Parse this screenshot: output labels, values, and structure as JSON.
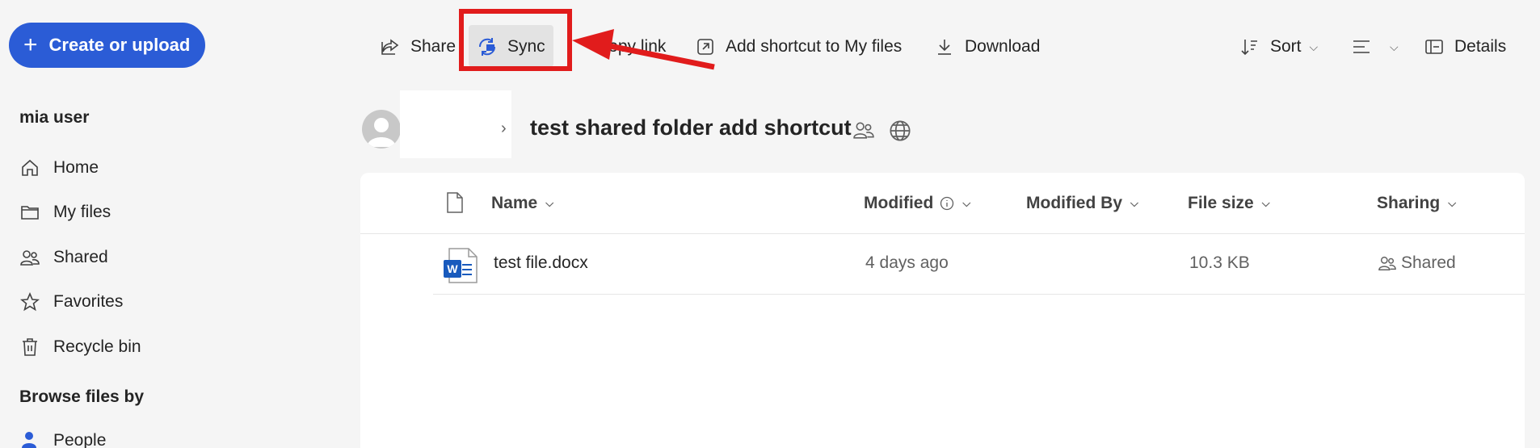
{
  "sidebar": {
    "create_label": "Create or upload",
    "user_name": "mia user",
    "items": [
      {
        "label": "Home",
        "icon": "home-icon"
      },
      {
        "label": "My files",
        "icon": "folder-icon"
      },
      {
        "label": "Shared",
        "icon": "people-icon"
      },
      {
        "label": "Favorites",
        "icon": "star-icon"
      },
      {
        "label": "Recycle bin",
        "icon": "trash-icon"
      }
    ],
    "browse_title": "Browse files by",
    "people_label": "People"
  },
  "toolbar": {
    "share": "Share",
    "sync": "Sync",
    "copy_link": "Copy link",
    "add_shortcut": "Add shortcut to My files",
    "download": "Download",
    "sort": "Sort",
    "details": "Details"
  },
  "breadcrumb": {
    "folder_title": "test shared folder add shortcut"
  },
  "list": {
    "columns": {
      "name": "Name",
      "modified": "Modified",
      "modified_by": "Modified By",
      "file_size": "File size",
      "sharing": "Sharing"
    },
    "rows": [
      {
        "name": "test file.docx",
        "modified": "4 days ago",
        "modified_by": "",
        "file_size": "10.3 KB",
        "sharing": "Shared"
      }
    ]
  },
  "colors": {
    "accent": "#2b5cd6",
    "highlight": "#e11c1c",
    "word_blue": "#185abd"
  }
}
